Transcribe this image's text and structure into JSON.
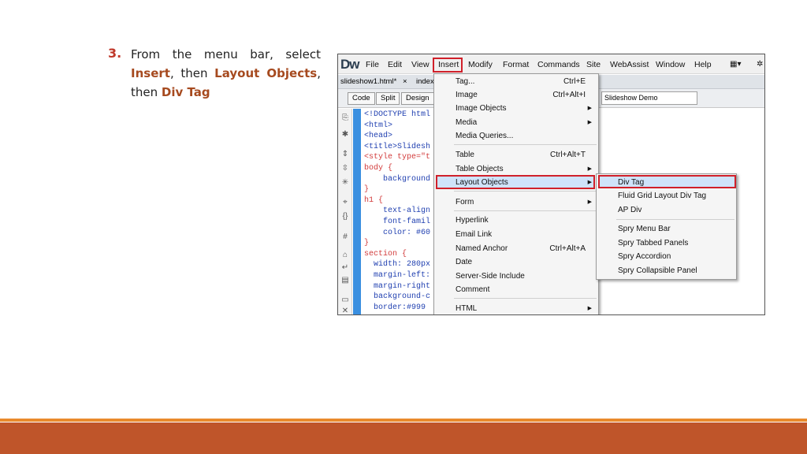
{
  "slide": {
    "step_number": "3.",
    "text_part1": "From the menu bar, select ",
    "insert": "Insert",
    "text_part2": ", then ",
    "layout_objects": "Layout Objects",
    "text_part3": ", then ",
    "div_tag": "Div Tag"
  },
  "colors": {
    "footer_bar": "#bf552a",
    "footer_line": "#e98a2c",
    "keyword": "#a64a1f",
    "highlight_border": "#d0202a"
  },
  "app": {
    "logo": "Dw",
    "menubar": [
      "File",
      "Edit",
      "View",
      "Insert",
      "Modify",
      "Format",
      "Commands",
      "Site",
      "WebAssist",
      "Window",
      "Help"
    ],
    "tabs": [
      "slideshow1.html*",
      "×",
      "index"
    ],
    "view_buttons": [
      "Code",
      "Split",
      "Design"
    ],
    "title_value": "Slideshow Demo",
    "code_lines": [
      "<!DOCTYPE html",
      "<html>",
      "<head>",
      "<title>Slidesh",
      "<style type=\"t",
      "body {",
      "    background",
      "}",
      "h1 {",
      "    text-align",
      "    font-famil",
      "    color: #60",
      "}",
      "section {",
      "  width: 280px",
      "  margin-left:",
      "  margin-right",
      "  background-c",
      "  border:#999"
    ]
  },
  "insert_menu": {
    "items": [
      {
        "label": "Tag...",
        "shortcut": "Ctrl+E"
      },
      {
        "label": "Image",
        "shortcut": "Ctrl+Alt+I"
      },
      {
        "label": "Image Objects",
        "submenu": true
      },
      {
        "label": "Media",
        "submenu": true
      },
      {
        "label": "Media Queries..."
      },
      {
        "label": "Table",
        "shortcut": "Ctrl+Alt+T"
      },
      {
        "label": "Table Objects",
        "submenu": true
      },
      {
        "label": "Layout Objects",
        "submenu": true
      },
      {
        "label": "Form",
        "submenu": true
      },
      {
        "label": "Hyperlink"
      },
      {
        "label": "Email Link"
      },
      {
        "label": "Named Anchor",
        "shortcut": "Ctrl+Alt+A"
      },
      {
        "label": "Date"
      },
      {
        "label": "Server-Side Include"
      },
      {
        "label": "Comment"
      },
      {
        "label": "HTML",
        "submenu": true
      }
    ],
    "arrow": "▶"
  },
  "layout_submenu": {
    "items": [
      "Div Tag",
      "Fluid Grid Layout Div Tag",
      "AP Div",
      "Spry Menu Bar",
      "Spry Tabbed Panels",
      "Spry Accordion",
      "Spry Collapsible Panel"
    ]
  }
}
